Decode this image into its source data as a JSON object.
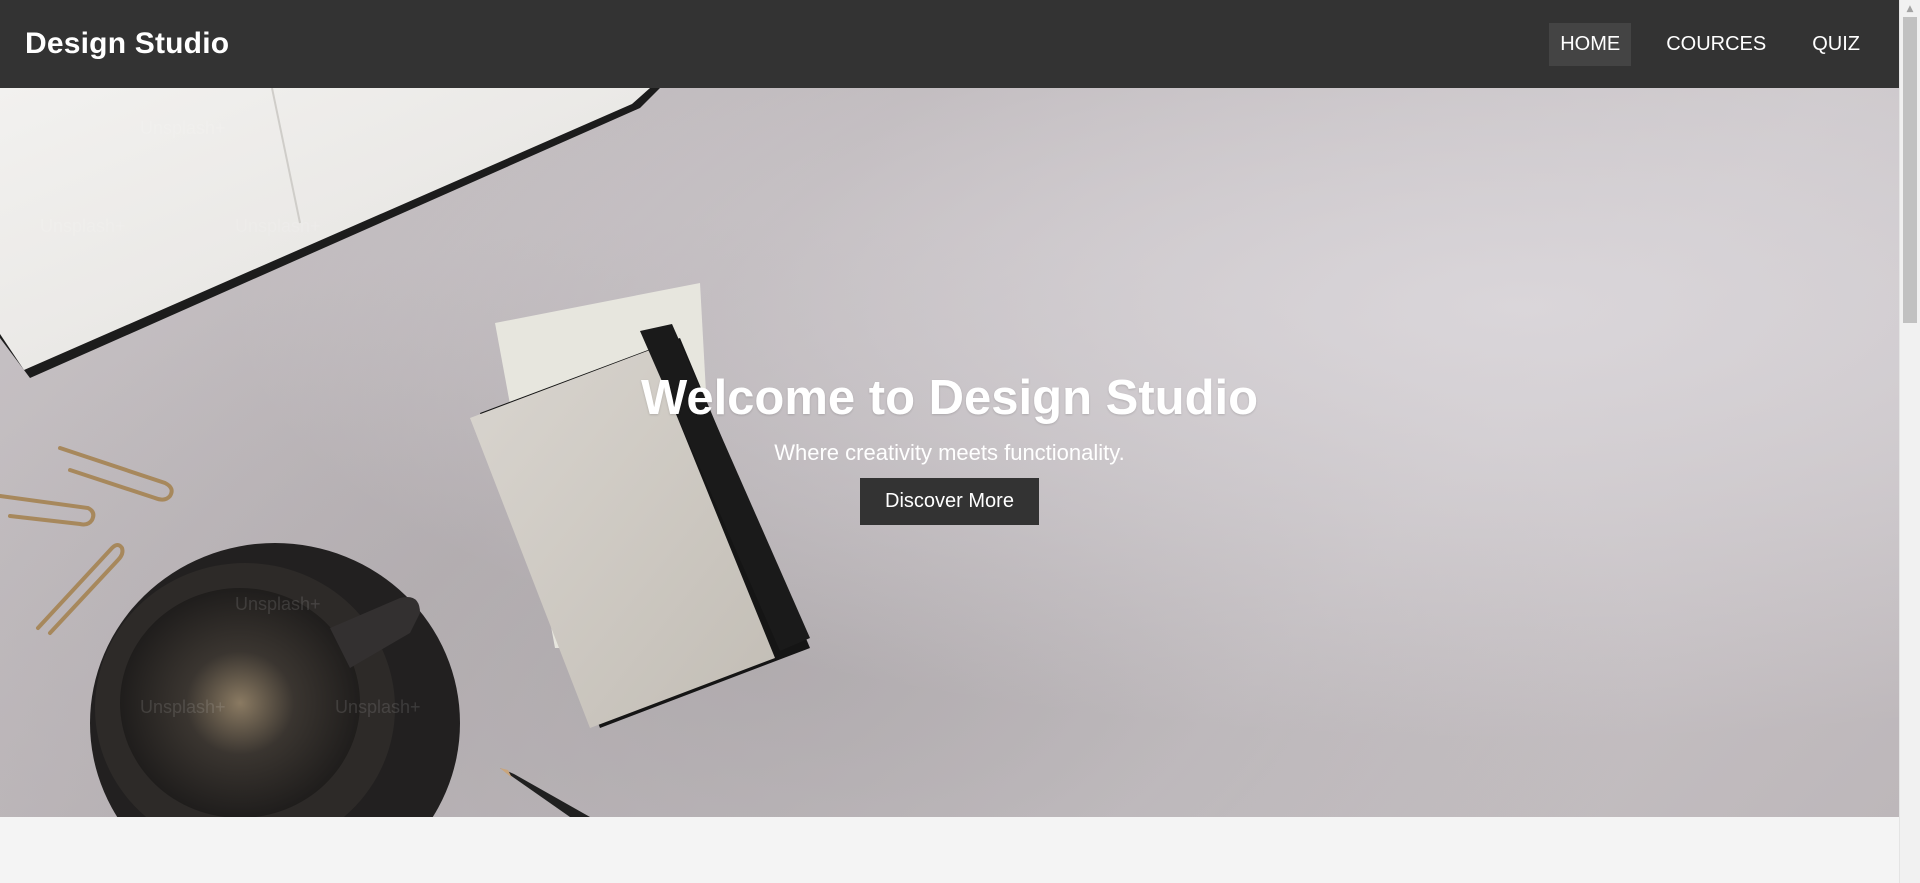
{
  "header": {
    "brand": "Design Studio",
    "nav": [
      {
        "label": "HOME",
        "active": true
      },
      {
        "label": "COURCES",
        "active": false
      },
      {
        "label": "QUIZ",
        "active": false
      }
    ],
    "background_color": "#333333"
  },
  "hero": {
    "title": "Welcome to Design Studio",
    "subtitle": "Where creativity meets functionality.",
    "button_label": "Discover More",
    "watermark": "Unsplash+"
  },
  "colors": {
    "accent": "#333333",
    "page_background": "#f4f4f4",
    "text_light": "#ffffff"
  },
  "scrollbar": {
    "arrow_up_icon": "▲"
  }
}
